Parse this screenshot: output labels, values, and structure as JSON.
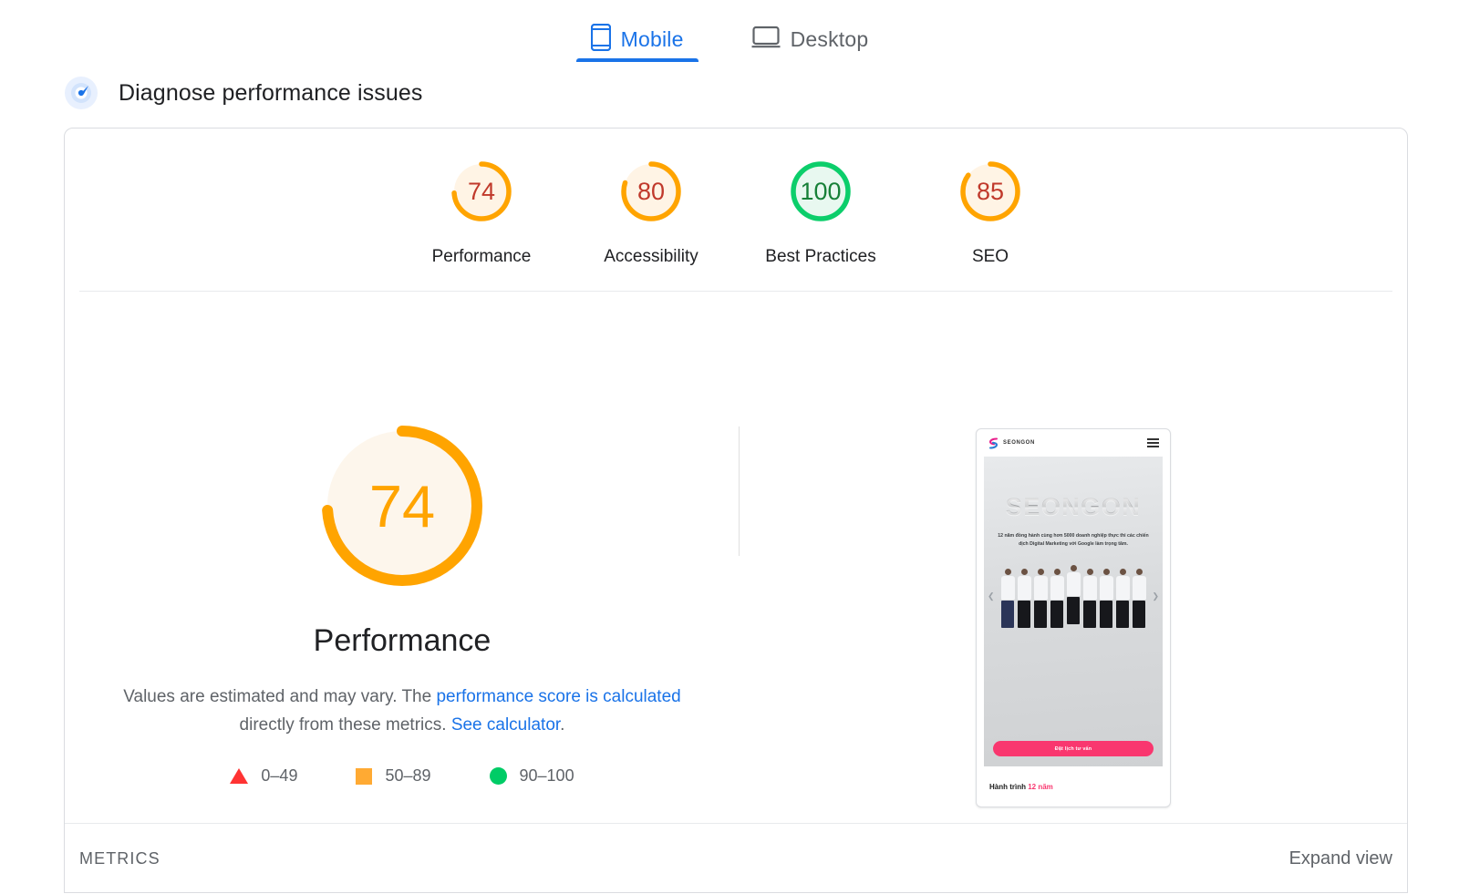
{
  "tabs": [
    {
      "label": "Mobile",
      "icon": "mobile-icon",
      "active": true
    },
    {
      "label": "Desktop",
      "icon": "desktop-icon",
      "active": false
    }
  ],
  "diagnose": {
    "icon": "lighthouse-gauge-icon",
    "title": "Diagnose performance issues"
  },
  "category_scores": [
    {
      "label": "Performance",
      "score": "74",
      "color": "#ffa400",
      "track": "#fff4e5",
      "num_color": "#c0392b"
    },
    {
      "label": "Accessibility",
      "score": "80",
      "color": "#ffa400",
      "track": "#fff4e5",
      "num_color": "#c0392b"
    },
    {
      "label": "Best Practices",
      "score": "100",
      "color": "#0cce6b",
      "track": "#e8f8f0",
      "num_color": "#178038"
    },
    {
      "label": "SEO",
      "score": "85",
      "color": "#ffa400",
      "track": "#fff4e5",
      "num_color": "#c0392b"
    }
  ],
  "main_score": {
    "value": "74",
    "title": "Performance",
    "color": "#ffa400",
    "track": "#fdf6ec"
  },
  "description": {
    "text_before": "Values are estimated and may vary. The ",
    "link1": "performance score is calculated",
    "text_middle": " directly from these metrics. ",
    "link2": "See calculator",
    "text_after": "."
  },
  "legend": [
    {
      "shape": "triangle",
      "range": "0–49",
      "color": "#ff3333"
    },
    {
      "shape": "square",
      "range": "50–89",
      "color": "#ffaa33"
    },
    {
      "shape": "circle",
      "range": "90–100",
      "color": "#00cc66"
    }
  ],
  "screenshot": {
    "site_name": "SEONGON",
    "wordmark": "SEONGON",
    "hero_text": "12 năm đồng hành cùng hơn 5000 doanh nghiệp thực thi các chiến dịch Digital Marketing với Google làm trọng tâm.",
    "cta": "Đặt lịch tư vấn",
    "footer_text": "Hành trình ",
    "footer_highlight": "12 năm",
    "menu_icon": "hamburger-menu-icon"
  },
  "footer": {
    "metrics_label": "METRICS",
    "expand_view": "Expand view"
  }
}
